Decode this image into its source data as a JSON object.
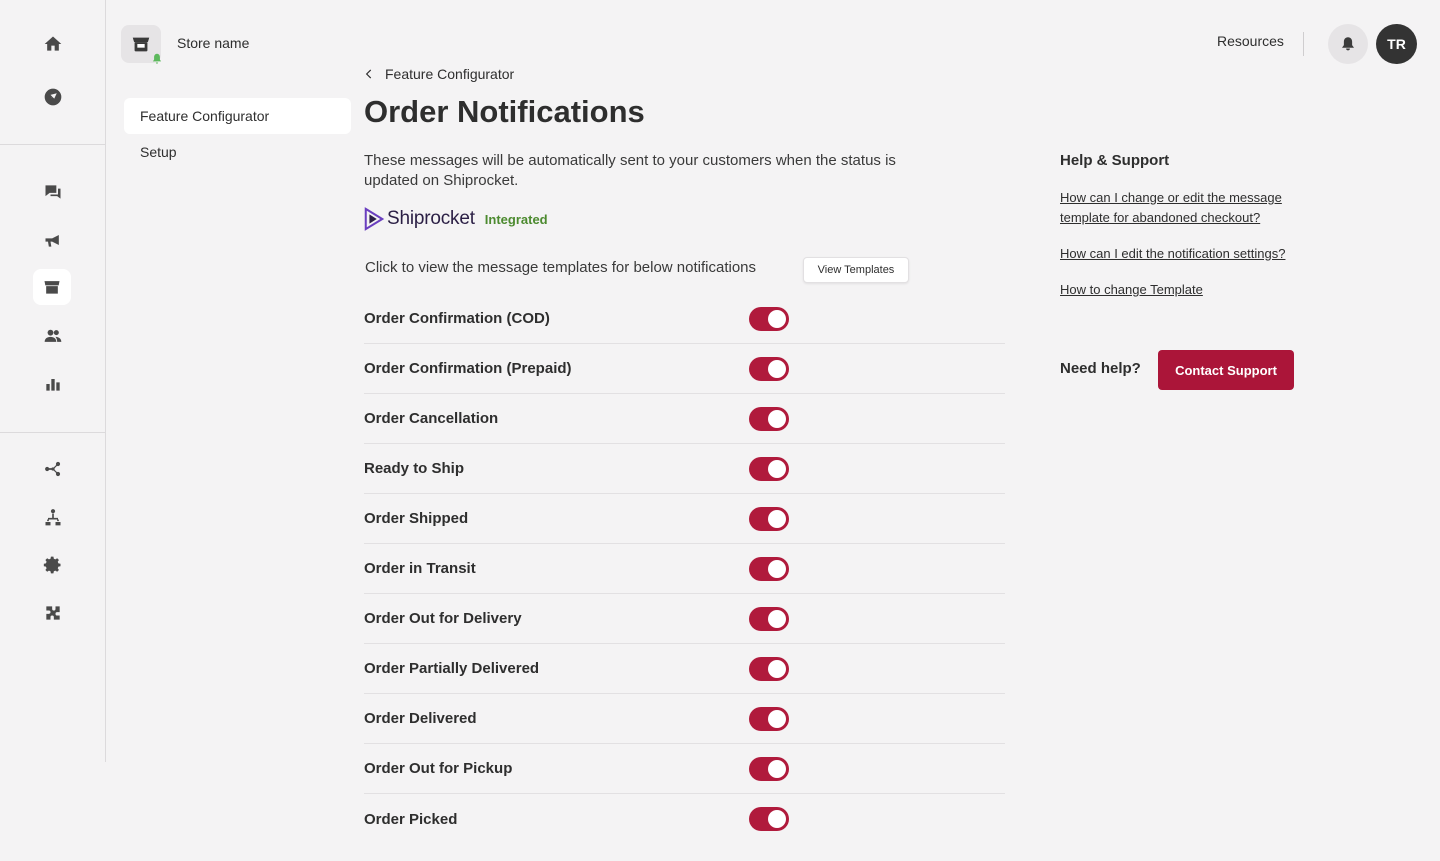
{
  "store": {
    "name": "Store name"
  },
  "subnav": {
    "items": [
      {
        "label": "Feature Configurator"
      },
      {
        "label": "Setup"
      }
    ]
  },
  "rail": {
    "icons": [
      "home-icon",
      "rocket-icon",
      "chat-icon",
      "megaphone-icon",
      "store-icon",
      "users-icon",
      "bar-chart-icon",
      "flow-icon",
      "sitemap-icon",
      "gear-icon",
      "puzzle-icon"
    ]
  },
  "header": {
    "resources_label": "Resources",
    "avatar_initials": "TR"
  },
  "breadcrumb": {
    "label": "Feature Configurator"
  },
  "page": {
    "title": "Order Notifications",
    "description": "These messages will be automatically sent to your customers when the status is updated on Shiprocket.",
    "integration_logo": "Shiprocket",
    "integration_status": "Integrated",
    "templates_hint": "Click to view the message templates for below notifications",
    "view_templates_label": "View Templates"
  },
  "notifications": [
    {
      "label": "Order Confirmation (COD)",
      "enabled": true
    },
    {
      "label": "Order Confirmation (Prepaid)",
      "enabled": true
    },
    {
      "label": "Order Cancellation",
      "enabled": true
    },
    {
      "label": "Ready to Ship",
      "enabled": true
    },
    {
      "label": "Order Shipped",
      "enabled": true
    },
    {
      "label": "Order in Transit",
      "enabled": true
    },
    {
      "label": "Order Out for Delivery",
      "enabled": true
    },
    {
      "label": "Order Partially Delivered",
      "enabled": true
    },
    {
      "label": "Order Delivered",
      "enabled": true
    },
    {
      "label": "Order Out for Pickup",
      "enabled": true
    },
    {
      "label": "Order Picked",
      "enabled": true
    }
  ],
  "help": {
    "title": "Help & Support",
    "links": [
      "How can I change or edit the message template for abandoned checkout?",
      "How can I edit the notification settings?",
      "How to change Template"
    ],
    "need_help_label": "Need help?",
    "contact_label": "Contact Support"
  },
  "colors": {
    "accent": "#ab1539",
    "toggle_on": "#b01a3c",
    "integrated": "#4c8a2f",
    "background": "#f4f3f4"
  }
}
